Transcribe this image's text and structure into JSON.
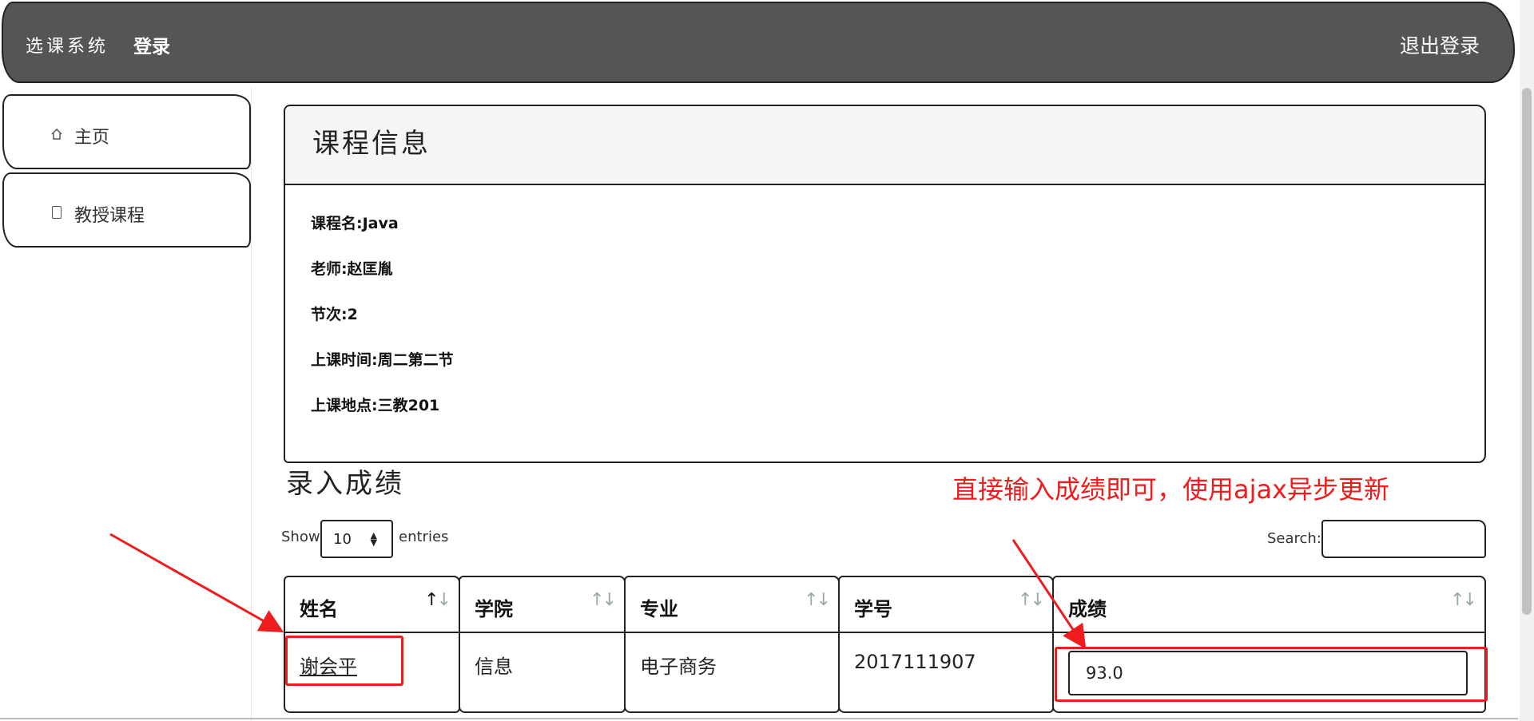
{
  "navbar": {
    "brand": "选课系统",
    "login": "登录",
    "logout": "退出登录"
  },
  "sidebar": {
    "items": [
      {
        "label": "主页",
        "icon": "home-icon"
      },
      {
        "label": "教授课程",
        "icon": "book-icon"
      }
    ]
  },
  "course_panel": {
    "title": "课程信息",
    "rows": [
      "课程名:Java",
      "老师:赵匡胤",
      "节次:2",
      "上课时间:周二第二节",
      "上课地点:三教201"
    ]
  },
  "grades": {
    "section_title": "录入成绩",
    "annotation": "直接输入成绩即可，使用ajax异步更新",
    "show_label": "Show",
    "page_length": "10",
    "entries_label": "entries",
    "search_label": "Search:",
    "search_value": "",
    "columns": [
      "姓名",
      "学院",
      "专业",
      "学号",
      "成绩"
    ],
    "rows": [
      {
        "name": "谢会平",
        "college": "信息",
        "major": "电子商务",
        "student_id": "2017111907",
        "grade": "93.0"
      }
    ]
  },
  "colors": {
    "navbar_bg": "#555555",
    "annotation_red": "#ee1c1c",
    "panel_head_bg": "#f5f5f5"
  }
}
